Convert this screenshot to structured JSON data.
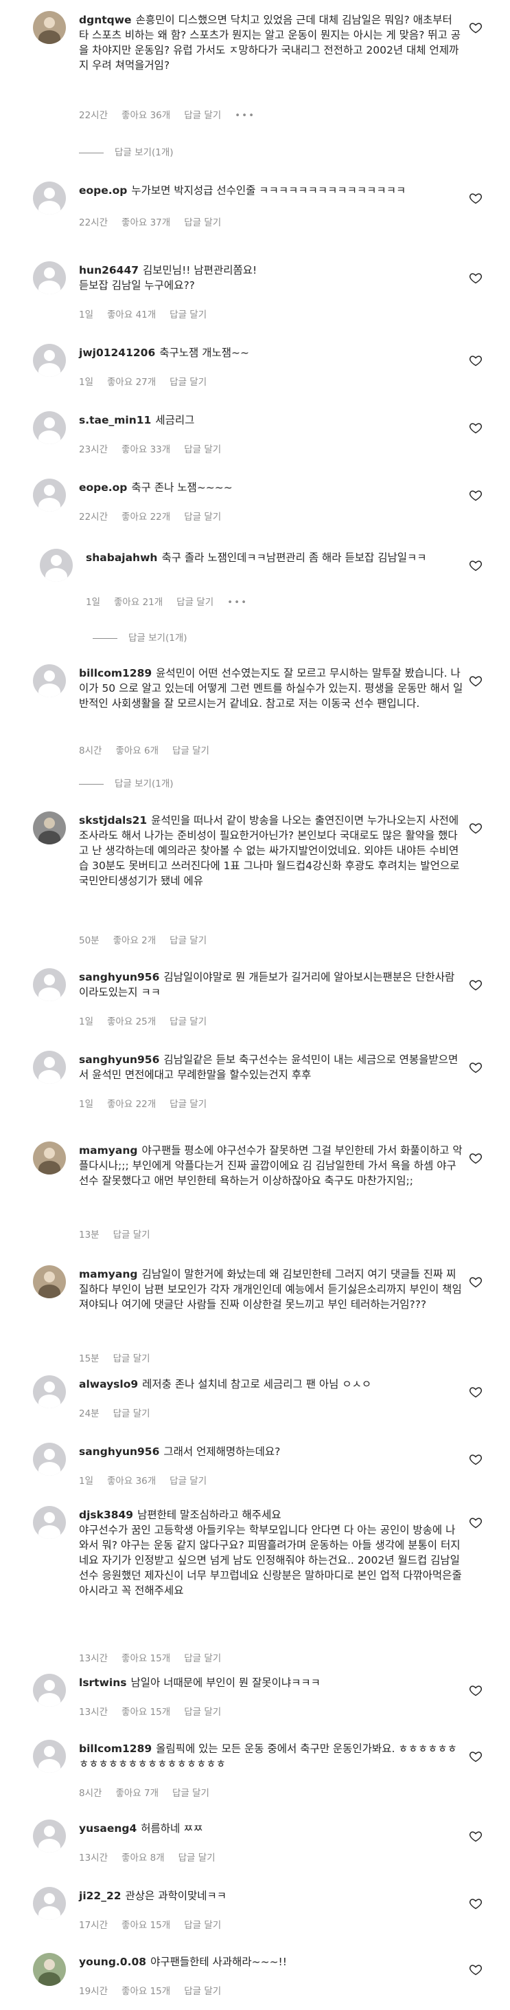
{
  "meta_labels": {
    "likes_prefix": "좋아요",
    "likes_suffix": "개",
    "reply": "답글 달기",
    "more": "•••"
  },
  "comments": [
    {
      "user": "dgntqwe",
      "text": "손흥민이 디스했으면 닥치고 있었음 근데 대체 김남일은 뭐임? 애초부터 타 스포츠 비하는 왜 함? 스포츠가 뭔지는 알고 운동이 뭔지는 아시는 게 맞음? 뛰고 공을 차야지만 운동임? 유럽 가서도 ㅈ망하다가 국내리그 전전하고 2002년 대체 언제까지 우려 쳐먹을거임?",
      "time": "22시간",
      "likes": "좋아요 36개",
      "reply": "답글 달기",
      "view_replies": "답글 보기(1개)"
    },
    {
      "user": "eope.op",
      "text": "누가보면 박지성급 선수인줄 ㅋㅋㅋㅋㅋㅋㅋㅋㅋㅋㅋㅋㅋㅋㅋ",
      "time": "22시간",
      "likes": "좋아요 37개",
      "reply": "답글 달기"
    },
    {
      "user": "hun26447",
      "text": "김보민님!! 남편관리쫌요!\n듣보잡 김남일 누구에요??",
      "time": "1일",
      "likes": "좋아요 41개",
      "reply": "답글 달기"
    },
    {
      "user": "jwj01241206",
      "text": "축구노잼 개노잼~~",
      "time": "1일",
      "likes": "좋아요 27개",
      "reply": "답글 달기"
    },
    {
      "user": "s.tae_min11",
      "text": "세금리그",
      "time": "23시간",
      "likes": "좋아요 33개",
      "reply": "답글 달기"
    },
    {
      "user": "eope.op",
      "text": "축구 존나 노잼~~~~",
      "time": "22시간",
      "likes": "좋아요 22개",
      "reply": "답글 달기"
    },
    {
      "user": "shabajahwh",
      "text": "축구 졸라 노잼인데ㅋㅋ남편관리 좀 해라 듣보잡 김남일ㅋㅋ",
      "time": "1일",
      "likes": "좋아요 21개",
      "reply": "답글 달기",
      "view_replies": "답글 보기(1개)"
    },
    {
      "user": "billcom1289",
      "text": "윤석민이 어떤 선수였는지도 잘 모르고 무시하는 말투잘 봤습니다. 나이가 50 으로 알고 있는데 어떻게 그런 멘트를 하실수가 있는지. 평생을 운동만 해서 일반적인 사회생활을 잘 모르시는거 같네요. 참고로 저는 이동국 선수 팬입니다.",
      "time": "8시간",
      "likes": "좋아요 6개",
      "reply": "답글 달기",
      "view_replies": "답글 보기(1개)"
    },
    {
      "user": "skstjdals21",
      "text": "윤석민을 떠나서 같이 방송을 나오는 출연진이면 누가나오는지 사전에 조사라도 해서 나가는 준비성이 필요한거아닌가? 본인보다 국대로도 많은 활약을 했다고 난 생각하는데 예의라곤 찾아볼 수 없는 싸가지발언이었네요. 외야든 내야든 수비연습 30분도 못버티고 쓰러진다에 1표 그나마 월드컵4강신화 후광도 후려치는 발언으로 국민안티생성기가 됐네 에유",
      "time": "50분",
      "likes": "좋아요 2개",
      "reply": "답글 달기"
    },
    {
      "user": "sanghyun956",
      "text": "김남일이야말로 뭔 개듣보가 길거리에 알아보시는팬분은 단한사람이라도있는지 ㅋㅋ",
      "time": "1일",
      "likes": "좋아요 25개",
      "reply": "답글 달기"
    },
    {
      "user": "sanghyun956",
      "text": "김남일같은 듣보 축구선수는 윤석민이 내는 세금으로 연봉을받으면서 윤석민 면전에대고 무례한말을 할수있는건지 후후",
      "time": "1일",
      "likes": "좋아요 22개",
      "reply": "답글 달기"
    },
    {
      "user": "mamyang",
      "text": "야구팬들 평소에 야구선수가 잘못하면 그걸 부인한테 가서 화풀이하고 악플다시나;;; 부인에게 악플다는거 진짜 골깝이에요 김 김남일한테 가서 욕을 하셈 야구선수 잘못했다고 애먼 부인한테 욕하는거 이상하잖아요 축구도 마찬가지임;;",
      "time": "13분",
      "likes": "",
      "reply": "답글 달기"
    },
    {
      "user": "mamyang",
      "text": "김남일이 말한거에 화났는데 왜 김보민한테 그러지 여기 댓글들 진짜 찌질하다 부인이 남편 보모인가 각자 개개인인데 예능에서 듣기싫은소리까지 부인이 책임져야되나 여기에 댓글단 사람들 진짜 이상한걸 못느끼고 부인 테러하는거임???",
      "time": "15분",
      "likes": "",
      "reply": "답글 달기"
    },
    {
      "user": "alwayslo9",
      "text": "레저충 존나 설치네 참고로 세금리그 팬 아님 ㅇㅅㅇ",
      "time": "24분",
      "likes": "",
      "reply": "답글 달기"
    },
    {
      "user": "sanghyun956",
      "text": "그래서 언제해명하는데요?",
      "time": "1일",
      "likes": "좋아요 36개",
      "reply": "답글 달기"
    },
    {
      "user": "djsk3849",
      "text": "남편한테 말조심하라고 해주세요\n야구선수가 꿈인 고등학생 아들키우는 학부모입니다 안다면 다 아는 공인이 방송에 나와서 뭐? 야구는 운동 같지 않다구요? 피땀흘려가며 운동하는 아들 생각에 분통이 터지네요 자기가 인정받고 싶으면 넘게 남도 인정해줘야 하는건요.. 2002년 월드컵 김남일 선수 응원했던 제자신이 너무 부끄럽네요 신랑분은 말하마디로 본인 업적 다깎아먹은줄 아시라고 꼭 전해주세요",
      "time": "13시간",
      "likes": "좋아요 15개",
      "reply": "답글 달기"
    },
    {
      "user": "lsrtwins",
      "text": "남일아 너때문에 부인이 뭔 잘못이냐ㅋㅋㅋ",
      "time": "13시간",
      "likes": "좋아요 15개",
      "reply": "답글 달기"
    },
    {
      "user": "billcom1289",
      "text": "올림픽에 있는 모든 운동 중에서 축구만 운동인가봐요. ㅎㅎㅎㅎㅎㅎㅎㅎㅎㅎㅎㅎㅎㅎㅎㅎㅎㅎㅎㅎㅎ",
      "time": "8시간",
      "likes": "좋아요 7개",
      "reply": "답글 달기"
    },
    {
      "user": "yusaeng4",
      "text": "허름하네 ㅉㅉ",
      "time": "13시간",
      "likes": "좋아요 8개",
      "reply": "답글 달기"
    },
    {
      "user": "ji22_22",
      "text": "관상은 과학이맞네ㅋㅋ",
      "time": "17시간",
      "likes": "좋아요 15개",
      "reply": "답글 달기"
    },
    {
      "user": "young.0.08",
      "text": "야구팬들한테 사과해라~~~!!",
      "time": "19시간",
      "likes": "좋아요 15개",
      "reply": "답글 달기"
    }
  ]
}
